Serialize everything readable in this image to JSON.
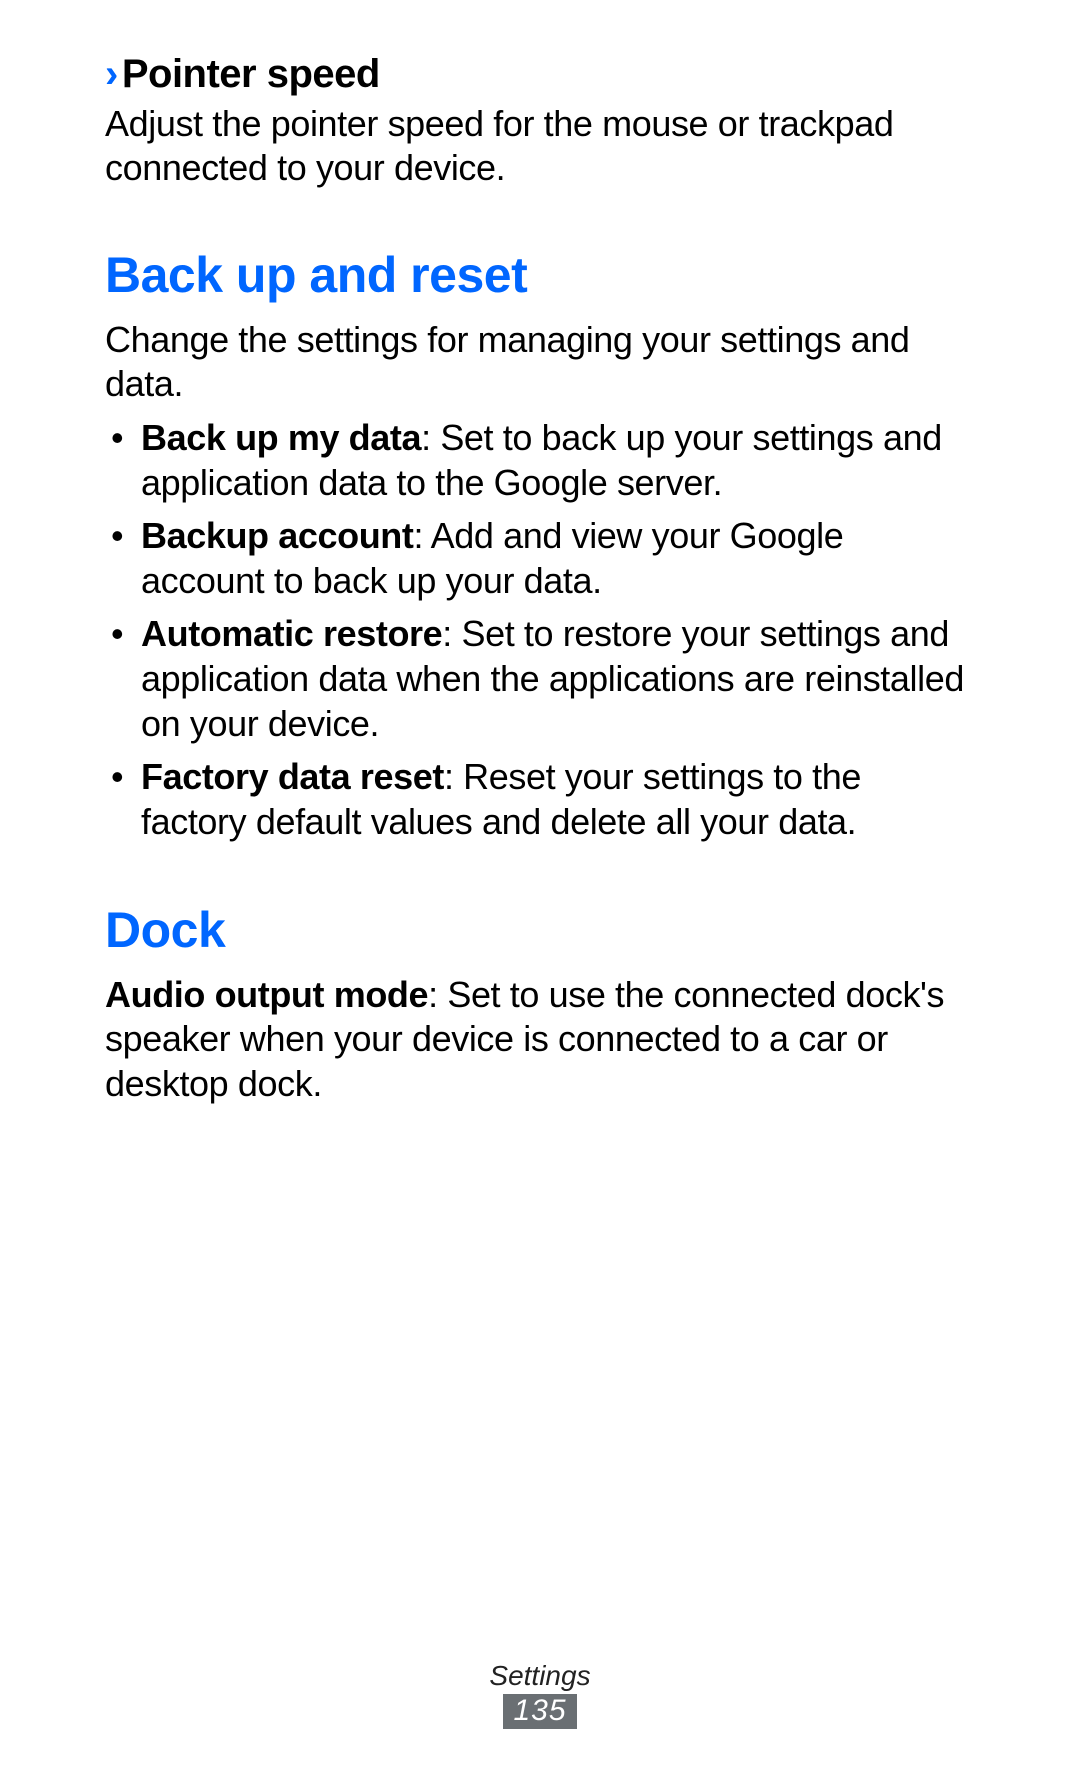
{
  "pointer": {
    "chevron": "›",
    "heading": "Pointer speed",
    "body": "Adjust the pointer speed for the mouse or trackpad connected to your device."
  },
  "backup": {
    "heading": "Back up and reset",
    "intro": "Change the settings for managing your settings and data.",
    "items": [
      {
        "term": "Back up my data",
        "desc": ": Set to back up your settings and application data to the Google server."
      },
      {
        "term": "Backup account",
        "desc": ": Add and view your Google account to back up your data."
      },
      {
        "term": "Automatic restore",
        "desc": ": Set to restore your settings and application data when the applications are reinstalled on your device."
      },
      {
        "term": "Factory data reset",
        "desc": ": Reset your settings to the factory default values and delete all your data."
      }
    ]
  },
  "dock": {
    "heading": "Dock",
    "term": "Audio output mode",
    "desc": ": Set to use the connected dock's speaker when your device is connected to a car or desktop dock."
  },
  "footer": {
    "section": "Settings",
    "page": "135"
  }
}
